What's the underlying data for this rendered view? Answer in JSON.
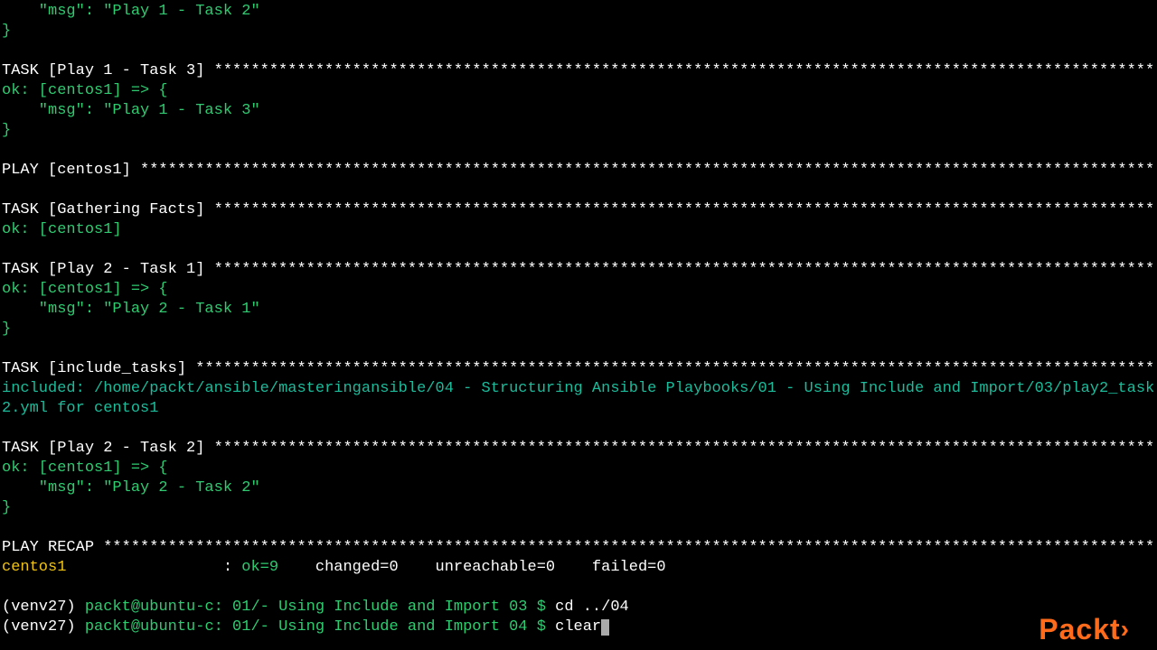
{
  "msg1": "    \"msg\": \"Play 1 - Task 2\"",
  "brace1": "}",
  "task3_header_label": "TASK [Play 1 - Task 3] ",
  "task3_stars": "*****************************************************************************************************************************************",
  "ok_arrow": "ok: [centos1] => {",
  "msg3": "    \"msg\": \"Play 1 - Task 3\"",
  "brace2": "}",
  "play_header_label": "PLAY [centos1] ",
  "play_stars": "*********************************************************************************************************************************************",
  "gathering_label": "TASK [Gathering Facts] ",
  "gathering_stars": "*****************************************************************************************************************************************",
  "ok_simple": "ok: [centos1]",
  "p2t1_label": "TASK [Play 2 - Task 1] ",
  "p2t1_stars": "*****************************************************************************************************************************************",
  "p2t1_msg": "    \"msg\": \"Play 2 - Task 1\"",
  "brace3": "}",
  "include_label": "TASK [include_tasks] ",
  "include_stars": "*******************************************************************************************************************************************",
  "included_prefix": "included: ",
  "included_path": "/home/packt/ansible/masteringansible/04 - Structuring Ansible Playbooks/01 - Using Include and Import/03/play2_task2.yml for centos1",
  "p2t2_label": "TASK [Play 2 - Task 2] ",
  "p2t2_stars": "*****************************************************************************************************************************************",
  "p2t2_msg": "    \"msg\": \"Play 2 - Task 2\"",
  "brace4": "}",
  "recap_label": "PLAY RECAP ",
  "recap_stars": "*************************************************************************************************************************************************",
  "recap_host": "centos1                 ",
  "recap_colon": ": ",
  "recap_ok": "ok=9   ",
  "recap_changed": " changed=0   ",
  "recap_unreach": " unreachable=0   ",
  "recap_failed": " failed=0",
  "venv": "(venv27) ",
  "prompt1_user": "packt@ubuntu-c: 01/- Using Include and Import 03 $ ",
  "cmd1": "cd ../04",
  "prompt2_user": "packt@ubuntu-c: 01/- Using Include and Import 04 $ ",
  "cmd2": "clear",
  "logo": "Packt"
}
